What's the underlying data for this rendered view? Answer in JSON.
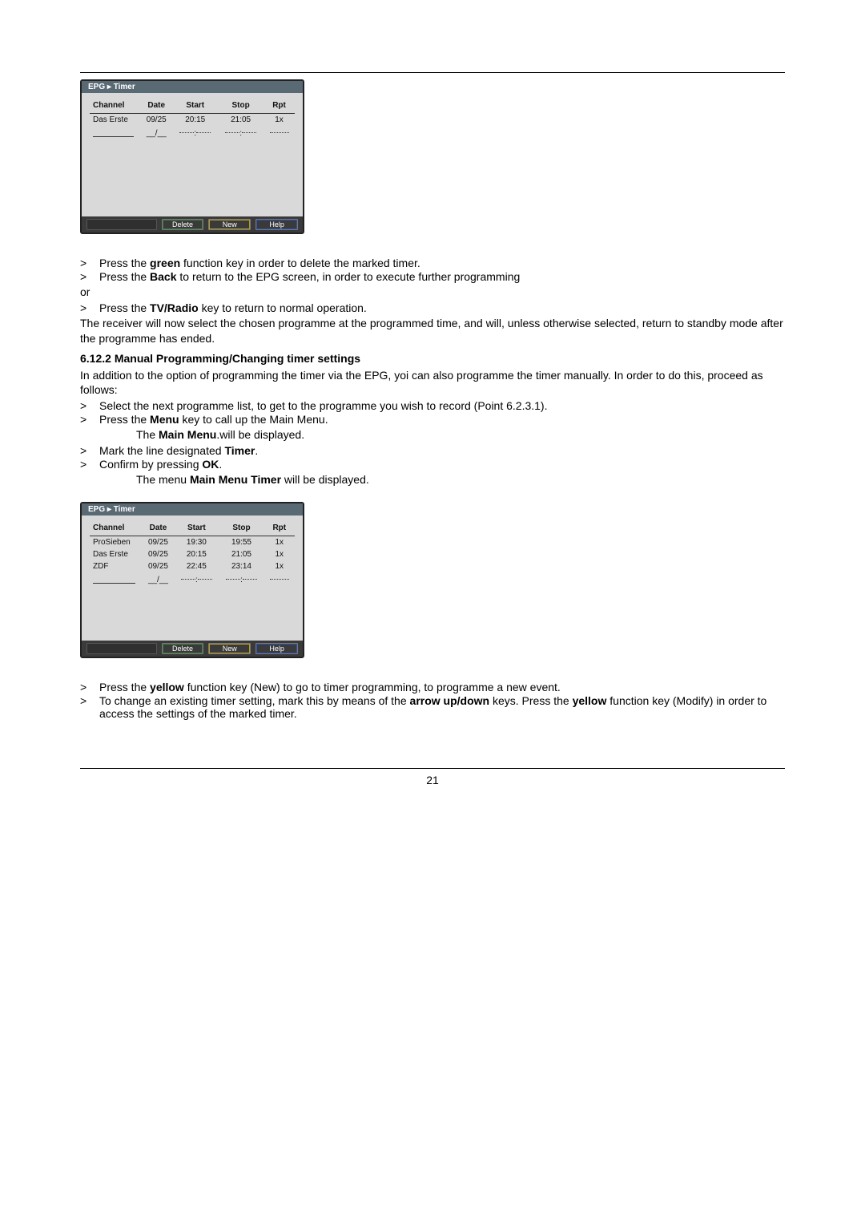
{
  "page_number": "21",
  "timer1": {
    "title": "EPG ▸ Timer",
    "headers": {
      "channel": "Channel",
      "date": "Date",
      "start": "Start",
      "stop": "Stop",
      "rpt": "Rpt"
    },
    "rows": [
      {
        "channel": "Das Erste",
        "date": "09/25",
        "start": "20:15",
        "stop": "21:05",
        "rpt": "1x"
      }
    ],
    "input_date": "__/__",
    "input_colon": ":",
    "btn_delete": "Delete",
    "btn_new": "New",
    "btn_help": "Help"
  },
  "timer2": {
    "title": "EPG ▸ Timer",
    "headers": {
      "channel": "Channel",
      "date": "Date",
      "start": "Start",
      "stop": "Stop",
      "rpt": "Rpt"
    },
    "rows": [
      {
        "channel": "ProSieben",
        "date": "09/25",
        "start": "19:30",
        "stop": "19:55",
        "rpt": "1x"
      },
      {
        "channel": "Das Erste",
        "date": "09/25",
        "start": "20:15",
        "stop": "21:05",
        "rpt": "1x"
      },
      {
        "channel": "ZDF",
        "date": "09/25",
        "start": "22:45",
        "stop": "23:14",
        "rpt": "1x"
      }
    ],
    "input_date": "__/__",
    "input_colon": ":",
    "btn_delete": "Delete",
    "btn_new": "New",
    "btn_help": "Help"
  },
  "txt": {
    "caret": ">",
    "or": "or",
    "s1a": "Press the ",
    "green": "green",
    "s1b": " function key in order to delete the marked timer.",
    "s2a": "Press the ",
    "back": "Back",
    "s2b": " to return to the EPG screen, in order to execute further programming",
    "s3a": "Press the ",
    "tvradio": "TV/Radio",
    "s3b": " key to return to normal operation.",
    "p1": "The receiver will now select the chosen programme at the programmed time, and will, unless otherwise selected, return to standby mode after the programme has ended.",
    "head": "6.12.2 Manual Programming/Changing timer settings",
    "p2": "In addition to the option of programming the timer via the EPG, yoi can also programme the timer manually. In order to do this, proceed as follows:",
    "s4": "Select the next programme list, to get to the programme you wish to record (Point 6.2.3.1).",
    "s5a": "Press the ",
    "menu": "Menu",
    "s5b": " key to call up the Main Menu.",
    "s5c_a": "The ",
    "mainmenu": "Main Menu",
    "s5c_b": ".will be displayed.",
    "s6a": "Mark the line designated ",
    "timerword": "Timer",
    "s6b": ".",
    "s7a": "Confirm by pressing ",
    "okword": "OK",
    "s7b": ".",
    "s7c_a": "The menu ",
    "mainmenutimer": "Main Menu Timer",
    "s7c_b": " will be displayed.",
    "s8a": "Press the ",
    "yellow": "yellow",
    "s8b": " function key (New) to go to timer programming, to programme a new event.",
    "s9a": "To change an existing timer setting, mark this by means of the ",
    "arrowud": "arrow up/down",
    "s9b": " keys. Press the ",
    "s9c": " function key (Modify) in order to access the settings of the marked timer."
  }
}
